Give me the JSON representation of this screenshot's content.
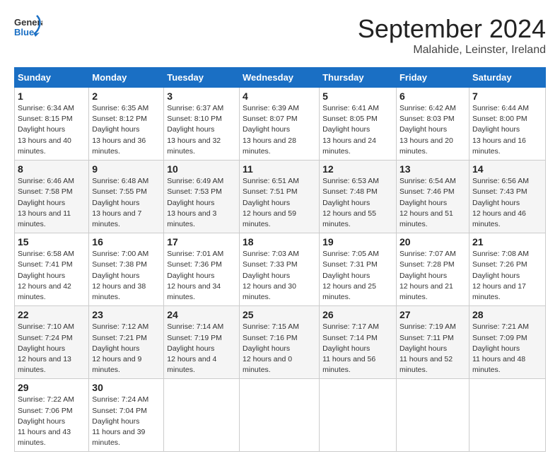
{
  "header": {
    "logo_line1": "General",
    "logo_line2": "Blue",
    "title": "September 2024",
    "subtitle": "Malahide, Leinster, Ireland"
  },
  "days_of_week": [
    "Sunday",
    "Monday",
    "Tuesday",
    "Wednesday",
    "Thursday",
    "Friday",
    "Saturday"
  ],
  "weeks": [
    [
      {
        "day": 1,
        "sunrise": "6:34 AM",
        "sunset": "8:15 PM",
        "daylight": "13 hours and 40 minutes."
      },
      {
        "day": 2,
        "sunrise": "6:35 AM",
        "sunset": "8:12 PM",
        "daylight": "13 hours and 36 minutes."
      },
      {
        "day": 3,
        "sunrise": "6:37 AM",
        "sunset": "8:10 PM",
        "daylight": "13 hours and 32 minutes."
      },
      {
        "day": 4,
        "sunrise": "6:39 AM",
        "sunset": "8:07 PM",
        "daylight": "13 hours and 28 minutes."
      },
      {
        "day": 5,
        "sunrise": "6:41 AM",
        "sunset": "8:05 PM",
        "daylight": "13 hours and 24 minutes."
      },
      {
        "day": 6,
        "sunrise": "6:42 AM",
        "sunset": "8:03 PM",
        "daylight": "13 hours and 20 minutes."
      },
      {
        "day": 7,
        "sunrise": "6:44 AM",
        "sunset": "8:00 PM",
        "daylight": "13 hours and 16 minutes."
      }
    ],
    [
      {
        "day": 8,
        "sunrise": "6:46 AM",
        "sunset": "7:58 PM",
        "daylight": "13 hours and 11 minutes."
      },
      {
        "day": 9,
        "sunrise": "6:48 AM",
        "sunset": "7:55 PM",
        "daylight": "13 hours and 7 minutes."
      },
      {
        "day": 10,
        "sunrise": "6:49 AM",
        "sunset": "7:53 PM",
        "daylight": "13 hours and 3 minutes."
      },
      {
        "day": 11,
        "sunrise": "6:51 AM",
        "sunset": "7:51 PM",
        "daylight": "12 hours and 59 minutes."
      },
      {
        "day": 12,
        "sunrise": "6:53 AM",
        "sunset": "7:48 PM",
        "daylight": "12 hours and 55 minutes."
      },
      {
        "day": 13,
        "sunrise": "6:54 AM",
        "sunset": "7:46 PM",
        "daylight": "12 hours and 51 minutes."
      },
      {
        "day": 14,
        "sunrise": "6:56 AM",
        "sunset": "7:43 PM",
        "daylight": "12 hours and 46 minutes."
      }
    ],
    [
      {
        "day": 15,
        "sunrise": "6:58 AM",
        "sunset": "7:41 PM",
        "daylight": "12 hours and 42 minutes."
      },
      {
        "day": 16,
        "sunrise": "7:00 AM",
        "sunset": "7:38 PM",
        "daylight": "12 hours and 38 minutes."
      },
      {
        "day": 17,
        "sunrise": "7:01 AM",
        "sunset": "7:36 PM",
        "daylight": "12 hours and 34 minutes."
      },
      {
        "day": 18,
        "sunrise": "7:03 AM",
        "sunset": "7:33 PM",
        "daylight": "12 hours and 30 minutes."
      },
      {
        "day": 19,
        "sunrise": "7:05 AM",
        "sunset": "7:31 PM",
        "daylight": "12 hours and 25 minutes."
      },
      {
        "day": 20,
        "sunrise": "7:07 AM",
        "sunset": "7:28 PM",
        "daylight": "12 hours and 21 minutes."
      },
      {
        "day": 21,
        "sunrise": "7:08 AM",
        "sunset": "7:26 PM",
        "daylight": "12 hours and 17 minutes."
      }
    ],
    [
      {
        "day": 22,
        "sunrise": "7:10 AM",
        "sunset": "7:24 PM",
        "daylight": "12 hours and 13 minutes."
      },
      {
        "day": 23,
        "sunrise": "7:12 AM",
        "sunset": "7:21 PM",
        "daylight": "12 hours and 9 minutes."
      },
      {
        "day": 24,
        "sunrise": "7:14 AM",
        "sunset": "7:19 PM",
        "daylight": "12 hours and 4 minutes."
      },
      {
        "day": 25,
        "sunrise": "7:15 AM",
        "sunset": "7:16 PM",
        "daylight": "12 hours and 0 minutes."
      },
      {
        "day": 26,
        "sunrise": "7:17 AM",
        "sunset": "7:14 PM",
        "daylight": "11 hours and 56 minutes."
      },
      {
        "day": 27,
        "sunrise": "7:19 AM",
        "sunset": "7:11 PM",
        "daylight": "11 hours and 52 minutes."
      },
      {
        "day": 28,
        "sunrise": "7:21 AM",
        "sunset": "7:09 PM",
        "daylight": "11 hours and 48 minutes."
      }
    ],
    [
      {
        "day": 29,
        "sunrise": "7:22 AM",
        "sunset": "7:06 PM",
        "daylight": "11 hours and 43 minutes."
      },
      {
        "day": 30,
        "sunrise": "7:24 AM",
        "sunset": "7:04 PM",
        "daylight": "11 hours and 39 minutes."
      },
      null,
      null,
      null,
      null,
      null
    ]
  ]
}
